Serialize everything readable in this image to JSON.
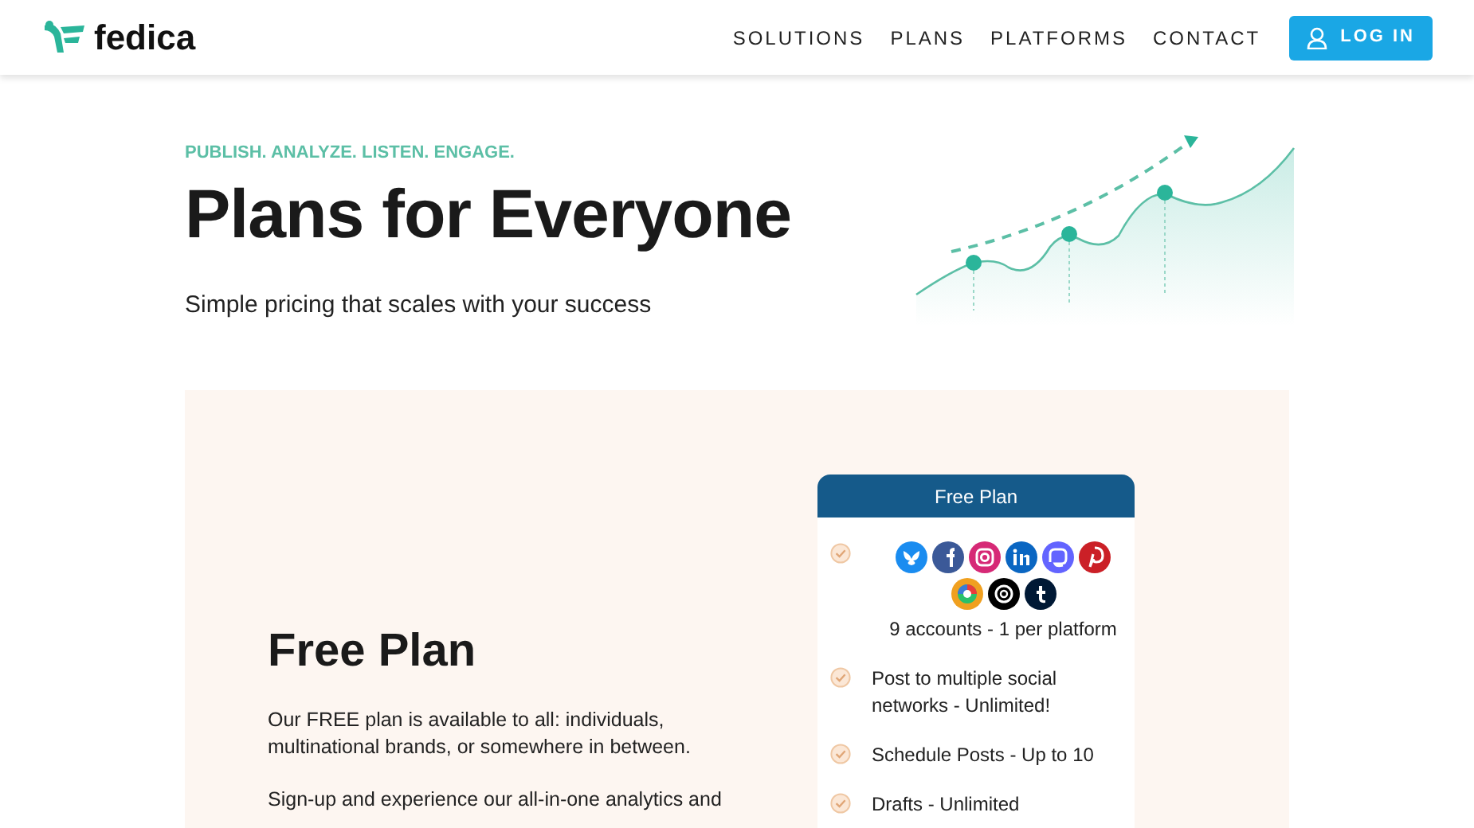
{
  "header": {
    "logo": "fedica",
    "nav": [
      {
        "label": "SOLUTIONS"
      },
      {
        "label": "PLANS"
      },
      {
        "label": "PLATFORMS"
      },
      {
        "label": "CONTACT"
      }
    ],
    "login": "LOG IN"
  },
  "hero": {
    "tagline": "PUBLISH. ANALYZE. LISTEN. ENGAGE.",
    "title": "Plans for Everyone",
    "subtitle": "Simple pricing that scales with your success"
  },
  "plan": {
    "title": "Free Plan",
    "paragraphs": [
      "Our FREE plan is available to all: individuals, multinational brands, or somewhere in between.",
      "Sign-up and experience our all-in-one analytics and"
    ],
    "card": {
      "title": "Free Plan",
      "features": [
        {
          "kind": "platforms",
          "text": "9 accounts - 1 per platform"
        },
        {
          "kind": "plain",
          "text": "Post to multiple social networks - Unlimited!"
        },
        {
          "kind": "plain",
          "text": "Schedule Posts - Up to 10"
        },
        {
          "kind": "plain",
          "text": "Drafts - Unlimited"
        }
      ]
    }
  }
}
